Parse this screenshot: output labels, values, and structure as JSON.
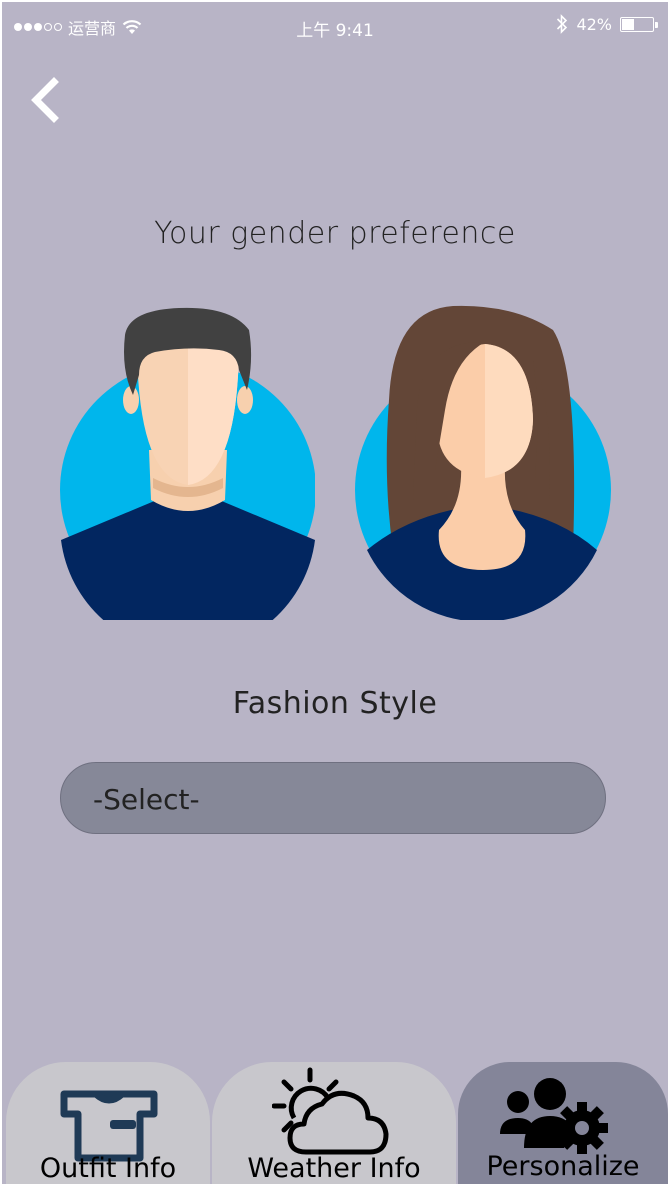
{
  "status_bar": {
    "carrier": "运营商",
    "time": "上午 9:41",
    "battery": "42%",
    "battery_level": 0.42
  },
  "page": {
    "title": "Your gender preference",
    "fashion_label": "Fashion Style",
    "select_value": "-Select-"
  },
  "tabs": [
    {
      "label": "Outfit Info",
      "icon": "tshirt-icon"
    },
    {
      "label": "Weather Info",
      "icon": "sun-cloud-icon"
    },
    {
      "label": "Personalize",
      "icon": "users-gear-icon"
    }
  ],
  "colors": {
    "background": "#b8b4c6",
    "avatar_circle": "#00b6ec",
    "shirt": "#022660",
    "select_fill": "#868898",
    "active_tab": "#848599",
    "inactive_tab": "#c8c7cc"
  }
}
